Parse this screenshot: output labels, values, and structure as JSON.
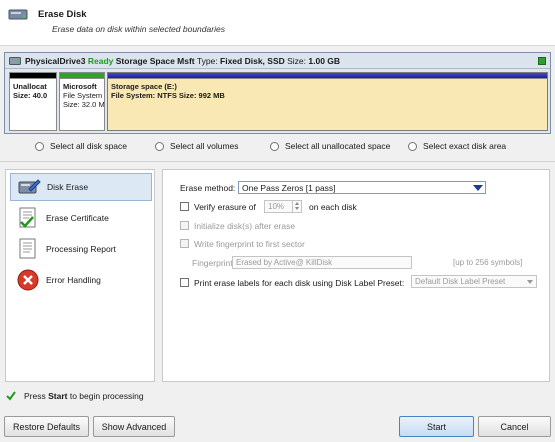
{
  "header": {
    "title": "Erase Disk",
    "subtitle": "Erase data on disk within selected boundaries",
    "icon": "erase-disk-icon"
  },
  "disk": {
    "name": "PhysicalDrive3",
    "status": "Ready",
    "model": "Storage Space Msft",
    "type_label": "Type:",
    "type_value": "Fixed Disk, SSD",
    "size_label": "Size:",
    "size_value": "1.00 GB",
    "status_color": "#1e9b1e",
    "partitions": [
      {
        "line1": "Unallocat",
        "line2": "Size: 40.0",
        "line3": "",
        "bar_color": "#000000"
      },
      {
        "line1": "Microsoft",
        "line2": "File System",
        "line3": "Size: 32.0 M",
        "bar_color": "#2aa52a"
      },
      {
        "line1": "Storage space (E:)",
        "line2": "File System: NTFS Size: 992 MB",
        "line3": "",
        "bar_color": "#1e1e9a",
        "fill_color": "#f9e8b3"
      }
    ]
  },
  "selection": {
    "options": [
      "Select all disk space",
      "Select all volumes",
      "Select all unallocated space",
      "Select exact disk area"
    ]
  },
  "nav": {
    "items": [
      {
        "label": "Disk Erase",
        "icon": "disk-erase-icon",
        "selected": true
      },
      {
        "label": "Erase Certificate",
        "icon": "certificate-icon",
        "selected": false
      },
      {
        "label": "Processing Report",
        "icon": "report-icon",
        "selected": false
      },
      {
        "label": "Error Handling",
        "icon": "error-icon",
        "selected": false
      }
    ]
  },
  "settings": {
    "erase_method_label": "Erase method:",
    "erase_method_value": "One Pass Zeros [1 pass]",
    "verify_label": "Verify erasure of",
    "verify_value": "10%",
    "verify_suffix": "on each disk",
    "initialize_label": "Initialize disk(s) after erase",
    "fingerprint_label": "Write fingerprint to first sector",
    "fingerprint_field_label": "Fingerprint:",
    "fingerprint_value": "Erased by Active@ KillDisk",
    "fingerprint_hint": "[up to 256 symbols]",
    "print_labels_label": "Print erase labels for each disk using Disk Label Preset:",
    "preset_value": "Default Disk Label Preset"
  },
  "status": {
    "prefix": "Press",
    "bold": "Start",
    "suffix": "to begin processing"
  },
  "buttons": {
    "restore": "Restore Defaults",
    "advanced": "Show Advanced",
    "start": "Start",
    "cancel": "Cancel"
  },
  "colors": {
    "accent": "#1c3c8c",
    "selected_nav": "#dde8f5",
    "ready_green": "#1e9b1e"
  }
}
